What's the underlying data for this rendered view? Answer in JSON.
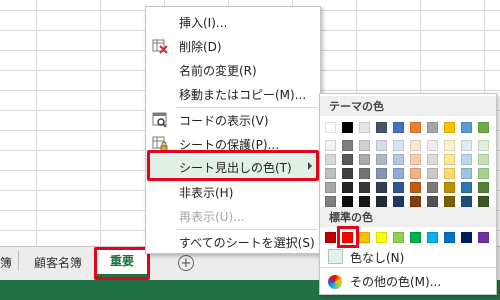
{
  "sheet_tabs": {
    "partial_label": "簿",
    "tab1_label": "顧客名簿",
    "tab2_label": "重要",
    "add_sheet_symbol": "+"
  },
  "context_menu": {
    "items": [
      {
        "label": "挿入(I)...",
        "icon": "",
        "enabled": true
      },
      {
        "label": "削除(D)",
        "icon": "delete-sheet-icon",
        "enabled": true
      },
      {
        "label": "名前の変更(R)",
        "icon": "",
        "enabled": true
      },
      {
        "label": "移動またはコピー(M)...",
        "icon": "",
        "enabled": true
      },
      {
        "label": "コードの表示(V)",
        "icon": "view-code-icon",
        "enabled": true
      },
      {
        "label": "シートの保護(P)...",
        "icon": "protect-sheet-icon",
        "enabled": true
      },
      {
        "label": "シート見出しの色(T)",
        "icon": "",
        "enabled": true,
        "active": true
      },
      {
        "label": "非表示(H)",
        "icon": "",
        "enabled": true
      },
      {
        "label": "再表示(U)...",
        "icon": "",
        "enabled": false
      },
      {
        "label": "すべてのシートを選択(S)",
        "icon": "",
        "enabled": true
      }
    ]
  },
  "color_submenu": {
    "theme_title": "テーマの色",
    "standard_title": "標準の色",
    "no_color_label": "色なし(N)",
    "more_colors_label": "その他の色(M)...",
    "theme_colors": [
      [
        "#ffffff",
        "#000000",
        "#e7e6e6",
        "#44546a",
        "#4472c4",
        "#ed7d31",
        "#a5a5a5",
        "#ffc000",
        "#5b9bd5",
        "#70ad47"
      ],
      [
        "#f2f2f2",
        "#7f7f7f",
        "#d0cece",
        "#d6dce5",
        "#dae3f3",
        "#fbe5d6",
        "#ededed",
        "#fff2cc",
        "#deebf7",
        "#e2f0d9"
      ],
      [
        "#d9d9d9",
        "#595959",
        "#afabab",
        "#adb9ca",
        "#b4c7e7",
        "#f8cbad",
        "#dbdbdb",
        "#ffe699",
        "#bdd7ee",
        "#c5e0b4"
      ],
      [
        "#bfbfbf",
        "#404040",
        "#767171",
        "#8497b0",
        "#8faadc",
        "#f4b183",
        "#c9c9c9",
        "#ffd966",
        "#9dc3e6",
        "#a9d18e"
      ],
      [
        "#a6a6a6",
        "#262626",
        "#3b3838",
        "#333f50",
        "#2f5597",
        "#c55a11",
        "#7b7b7b",
        "#bf9000",
        "#2e75b6",
        "#548235"
      ],
      [
        "#7f7f7f",
        "#0d0d0d",
        "#171717",
        "#222a35",
        "#1f3864",
        "#843c0c",
        "#525252",
        "#7f6000",
        "#1f4e79",
        "#385723"
      ]
    ],
    "standard_colors": [
      "#c00000",
      "#ff0000",
      "#ffc000",
      "#ffff00",
      "#92d050",
      "#00b050",
      "#00b0f0",
      "#0070c0",
      "#002060",
      "#7030a0"
    ]
  }
}
